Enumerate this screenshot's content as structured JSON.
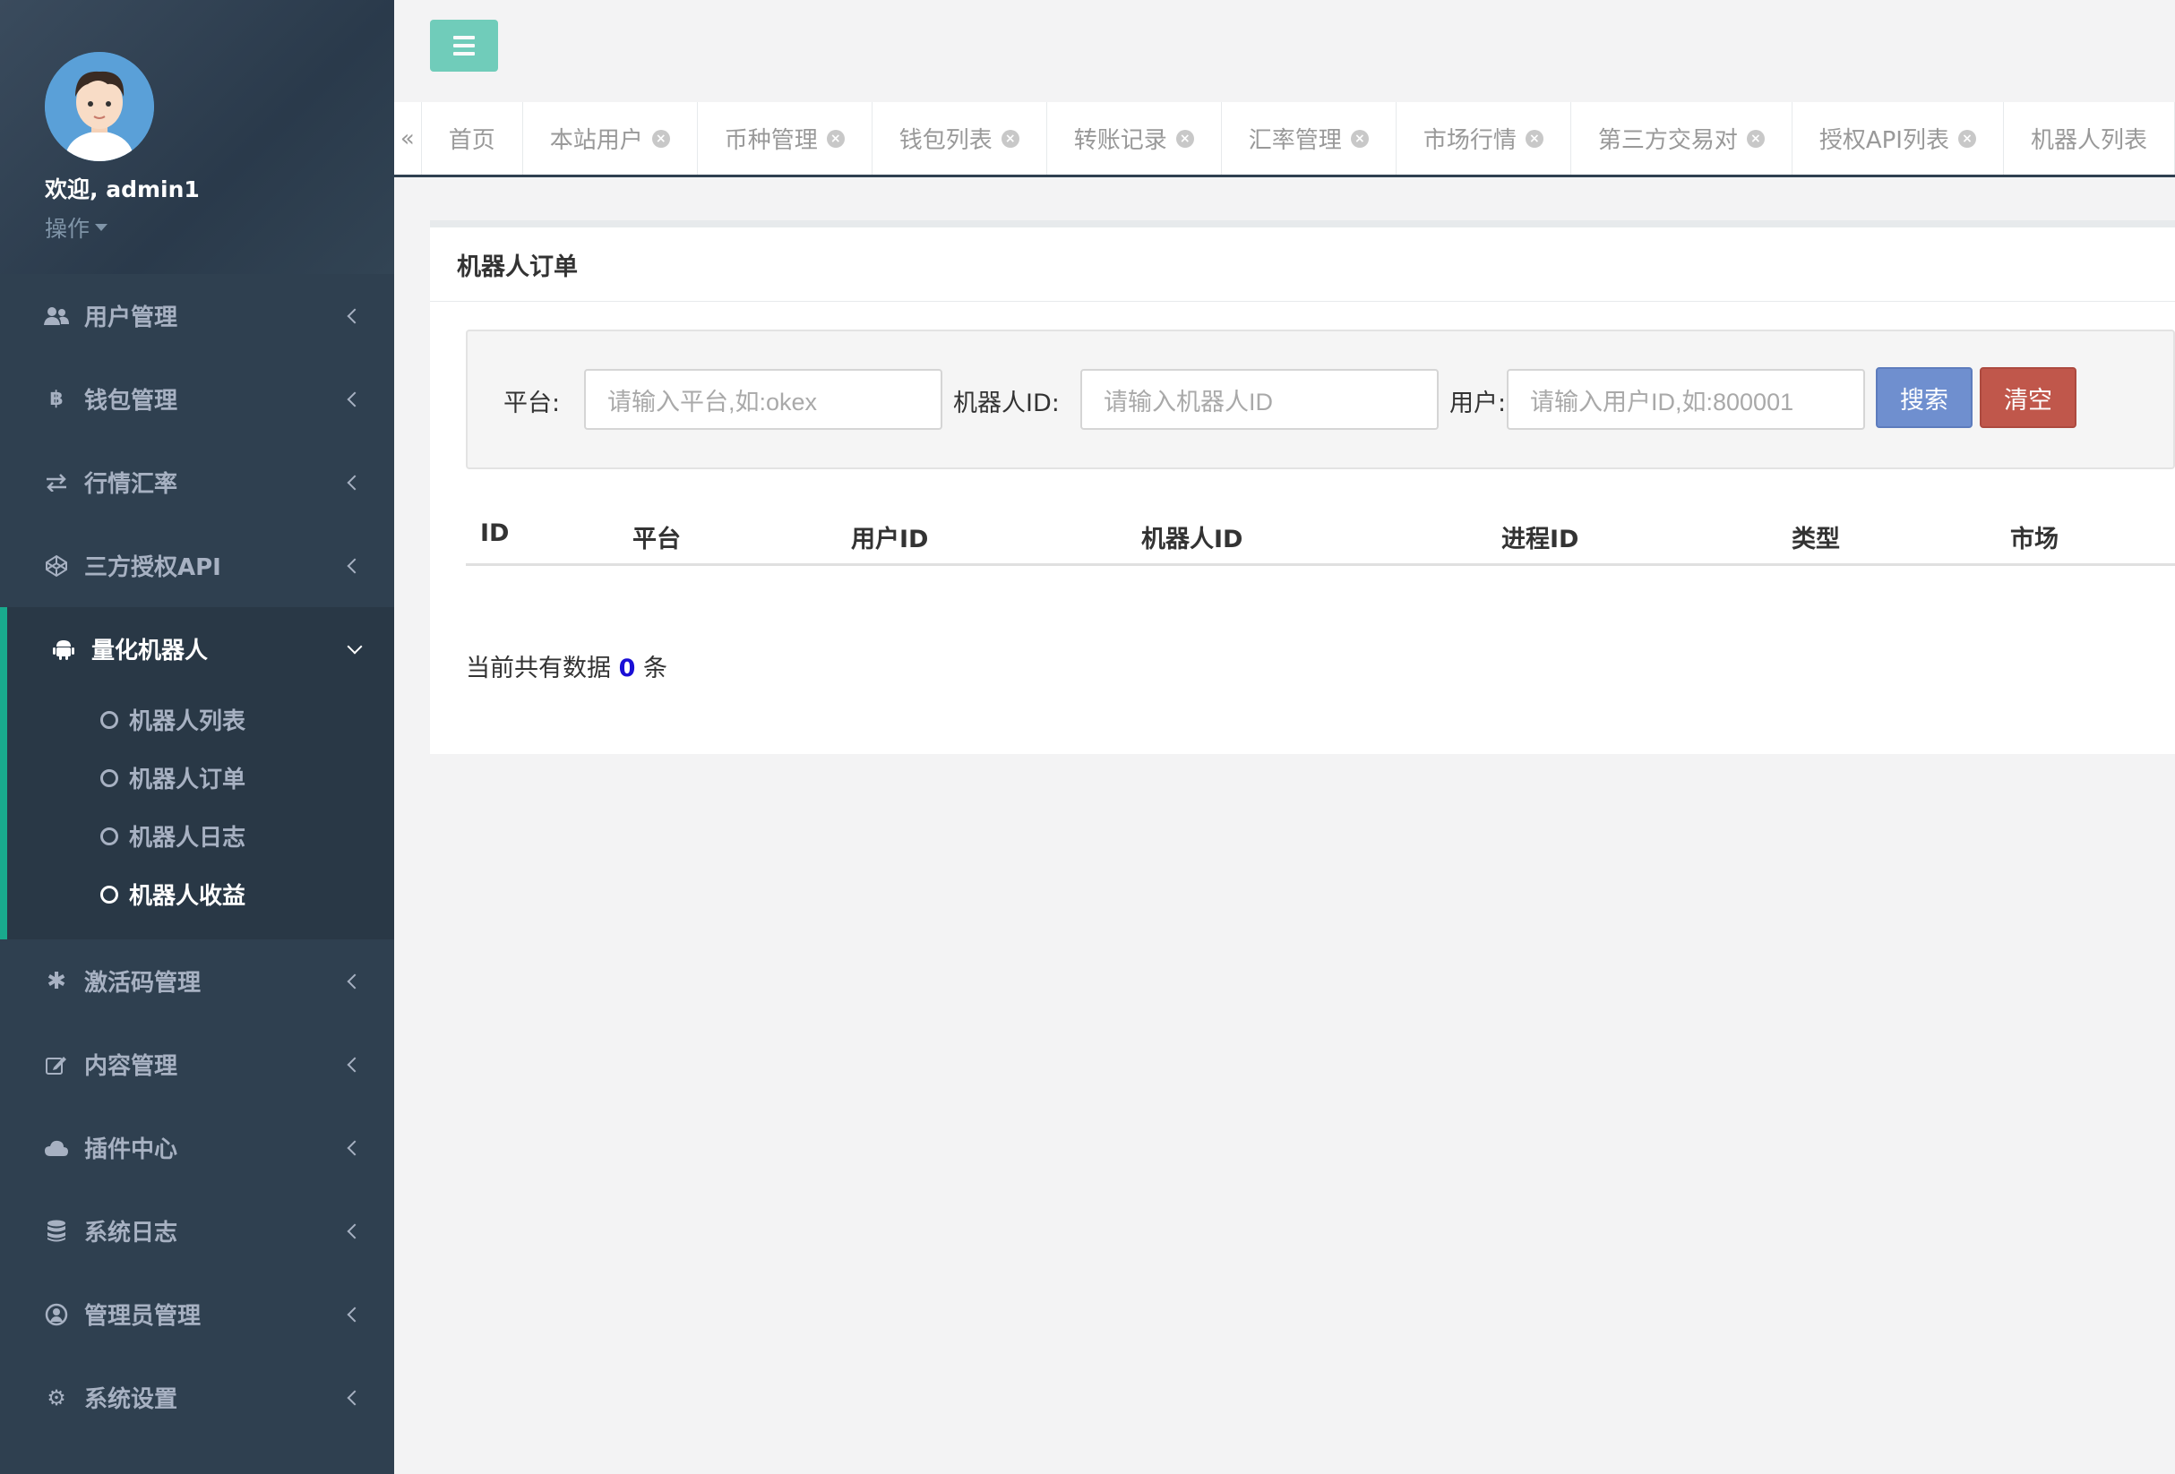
{
  "sidebar": {
    "welcome": "欢迎, admin1",
    "ops": "操作",
    "items": [
      {
        "label": "用户管理",
        "icon": "users-icon"
      },
      {
        "label": "钱包管理",
        "icon": "bitcoin-icon"
      },
      {
        "label": "行情汇率",
        "icon": "exchange-icon"
      },
      {
        "label": "三方授权API",
        "icon": "codepen-icon"
      }
    ],
    "active": {
      "label": "量化机器人",
      "icon": "android-icon",
      "children": [
        "机器人列表",
        "机器人订单",
        "机器人日志",
        "机器人收益"
      ]
    },
    "items_after": [
      {
        "label": "激活码管理",
        "icon": "gear-icon"
      },
      {
        "label": "内容管理",
        "icon": "edit-icon"
      },
      {
        "label": "插件中心",
        "icon": "cloud-icon"
      },
      {
        "label": "系统日志",
        "icon": "database-icon"
      },
      {
        "label": "管理员管理",
        "icon": "user-circle-icon"
      },
      {
        "label": "系统设置",
        "icon": "cogs-icon"
      }
    ]
  },
  "tabs": [
    "首页",
    "本站用户",
    "币种管理",
    "钱包列表",
    "转账记录",
    "汇率管理",
    "市场行情",
    "第三方交易对",
    "授权API列表",
    "机器人列表"
  ],
  "panel": {
    "title": "机器人订单",
    "search": {
      "platform_label": "平台:",
      "platform_placeholder": "请输入平台,如:okex",
      "robot_label": "机器人ID:",
      "robot_placeholder": "请输入机器人ID",
      "user_label": "用户:",
      "user_placeholder": "请输入用户ID,如:800001",
      "search_btn": "搜索",
      "clear_btn": "清空"
    },
    "columns": [
      "ID",
      "平台",
      "用户ID",
      "机器人ID",
      "进程ID",
      "类型",
      "市场"
    ],
    "count_prefix": "当前共有数据",
    "count": "0",
    "count_suffix": "条"
  }
}
